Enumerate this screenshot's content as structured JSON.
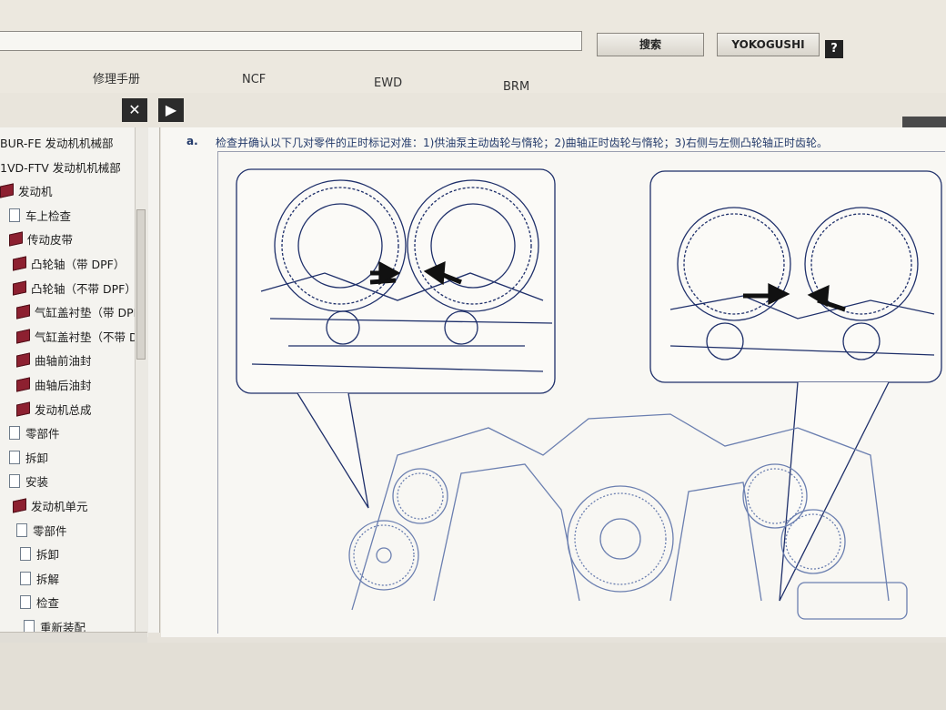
{
  "header": {
    "search_value": "",
    "search_button": "搜索",
    "yokogushi_button": "YOKOGUSHI",
    "help_button": "?"
  },
  "tabs": [
    "修理手册",
    "NCF",
    "EWD",
    "BRM"
  ],
  "toolbar": {
    "close_label": "✕",
    "next_label": "▶"
  },
  "sidebar": {
    "items": [
      {
        "label": "BUR-FE 发动机机械部",
        "icon": "none"
      },
      {
        "label": "1VD-FTV 发动机机械部",
        "icon": "none"
      },
      {
        "label": "发动机",
        "icon": "book-icon"
      },
      {
        "label": "车上检查",
        "icon": "page-icon"
      },
      {
        "label": "传动皮带",
        "icon": "book-icon"
      },
      {
        "label": "凸轮轴（带 DPF）",
        "icon": "book-icon"
      },
      {
        "label": "凸轮轴（不带 DPF）",
        "icon": "book-icon"
      },
      {
        "label": "气缸盖衬垫（带 DPF",
        "icon": "book-icon"
      },
      {
        "label": "气缸盖衬垫（不带 D",
        "icon": "book-icon"
      },
      {
        "label": "曲轴前油封",
        "icon": "book-icon"
      },
      {
        "label": "曲轴后油封",
        "icon": "book-icon"
      },
      {
        "label": "发动机总成",
        "icon": "book-icon"
      },
      {
        "label": "零部件",
        "icon": "page-icon"
      },
      {
        "label": "拆卸",
        "icon": "page-icon"
      },
      {
        "label": "安装",
        "icon": "page-icon"
      },
      {
        "label": "发动机单元",
        "icon": "book-icon"
      },
      {
        "label": "零部件",
        "icon": "page-icon"
      },
      {
        "label": "拆卸",
        "icon": "page-icon"
      },
      {
        "label": "拆解",
        "icon": "page-icon"
      },
      {
        "label": "检查",
        "icon": "page-icon"
      },
      {
        "label": "重新装配",
        "icon": "page-icon"
      }
    ]
  },
  "content": {
    "step_label": "a.",
    "instruction": "检查并确认以下几对零件的正时标记对准：1)供油泵主动齿轮与惰轮；2)曲轴正时齿轮与惰轮；3)右侧与左侧凸轮轴正时齿轮。"
  },
  "colors": {
    "line_art": "#1e2f6a",
    "icon_book": "#8d2030",
    "text_blue": "#233a6a"
  }
}
